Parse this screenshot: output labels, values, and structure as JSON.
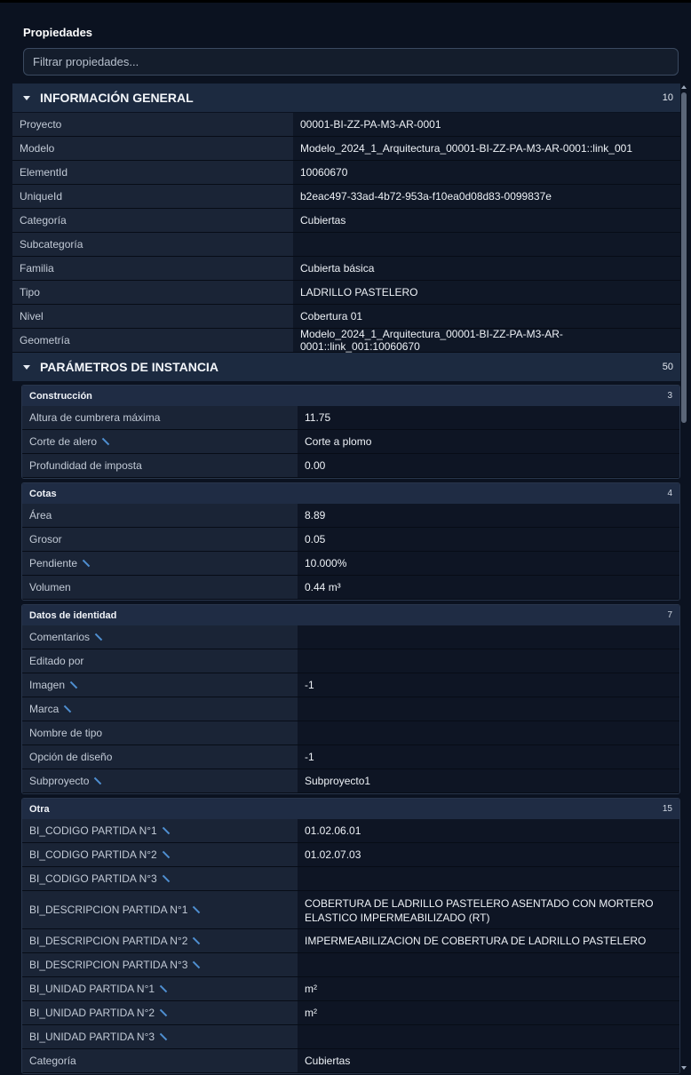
{
  "panel": {
    "title": "Propiedades",
    "filter_placeholder": "Filtrar propiedades..."
  },
  "general": {
    "title": "INFORMACIÓN GENERAL",
    "count": "10",
    "rows": [
      {
        "k": "Proyecto",
        "v": "00001-BI-ZZ-PA-M3-AR-0001"
      },
      {
        "k": "Modelo",
        "v": "Modelo_2024_1_Arquitectura_00001-BI-ZZ-PA-M3-AR-0001::link_001"
      },
      {
        "k": "ElementId",
        "v": "10060670"
      },
      {
        "k": "UniqueId",
        "v": "b2eac497-33ad-4b72-953a-f10ea0d08d83-0099837e"
      },
      {
        "k": "Categoría",
        "v": "Cubiertas"
      },
      {
        "k": "Subcategoría",
        "v": ""
      },
      {
        "k": "Familia",
        "v": "Cubierta básica"
      },
      {
        "k": "Tipo",
        "v": "LADRILLO PASTELERO"
      },
      {
        "k": "Nivel",
        "v": "Cobertura 01"
      },
      {
        "k": "Geometría",
        "v": "Modelo_2024_1_Arquitectura_00001-BI-ZZ-PA-M3-AR-0001::link_001:10060670"
      }
    ]
  },
  "instance": {
    "title": "PARÁMETROS DE INSTANCIA",
    "count": "50",
    "groups": [
      {
        "title": "Construcción",
        "count": "3",
        "rows": [
          {
            "k": "Altura de cumbrera máxima",
            "v": "11.75",
            "edit": false
          },
          {
            "k": "Corte de alero",
            "v": "Corte a plomo",
            "edit": true
          },
          {
            "k": "Profundidad de imposta",
            "v": "0.00",
            "edit": false
          }
        ]
      },
      {
        "title": "Cotas",
        "count": "4",
        "rows": [
          {
            "k": "Área",
            "v": "8.89",
            "edit": false
          },
          {
            "k": "Grosor",
            "v": "0.05",
            "edit": false
          },
          {
            "k": "Pendiente",
            "v": "10.000%",
            "edit": true
          },
          {
            "k": "Volumen",
            "v": "0.44 m³",
            "edit": false
          }
        ]
      },
      {
        "title": "Datos de identidad",
        "count": "7",
        "rows": [
          {
            "k": "Comentarios",
            "v": "",
            "edit": true
          },
          {
            "k": "Editado por",
            "v": "",
            "edit": false
          },
          {
            "k": "Imagen",
            "v": "-1",
            "edit": true
          },
          {
            "k": "Marca",
            "v": "",
            "edit": true
          },
          {
            "k": "Nombre de tipo",
            "v": "",
            "edit": false
          },
          {
            "k": "Opción de diseño",
            "v": "-1",
            "edit": false
          },
          {
            "k": "Subproyecto",
            "v": "Subproyecto1",
            "edit": true
          }
        ]
      },
      {
        "title": "Otra",
        "count": "15",
        "rows": [
          {
            "k": "BI_CODIGO PARTIDA N°1",
            "v": "01.02.06.01",
            "edit": true
          },
          {
            "k": "BI_CODIGO PARTIDA N°2",
            "v": "01.02.07.03",
            "edit": true
          },
          {
            "k": "BI_CODIGO PARTIDA N°3",
            "v": "",
            "edit": true
          },
          {
            "k": "BI_DESCRIPCION PARTIDA N°1",
            "v": "COBERTURA DE LADRILLO PASTELERO ASENTADO CON MORTERO ELASTICO IMPERMEABILIZADO (RT)",
            "edit": true,
            "tall": true
          },
          {
            "k": "BI_DESCRIPCION PARTIDA N°2",
            "v": "IMPERMEABILIZACION DE COBERTURA DE LADRILLO PASTELERO",
            "edit": true
          },
          {
            "k": "BI_DESCRIPCION PARTIDA N°3",
            "v": "",
            "edit": true
          },
          {
            "k": "BI_UNIDAD PARTIDA N°1",
            "v": "m²",
            "edit": true
          },
          {
            "k": "BI_UNIDAD PARTIDA N°2",
            "v": "m²",
            "edit": true
          },
          {
            "k": "BI_UNIDAD PARTIDA N°3",
            "v": "",
            "edit": true
          },
          {
            "k": "Categoría",
            "v": "Cubiertas",
            "edit": false
          }
        ]
      }
    ]
  }
}
